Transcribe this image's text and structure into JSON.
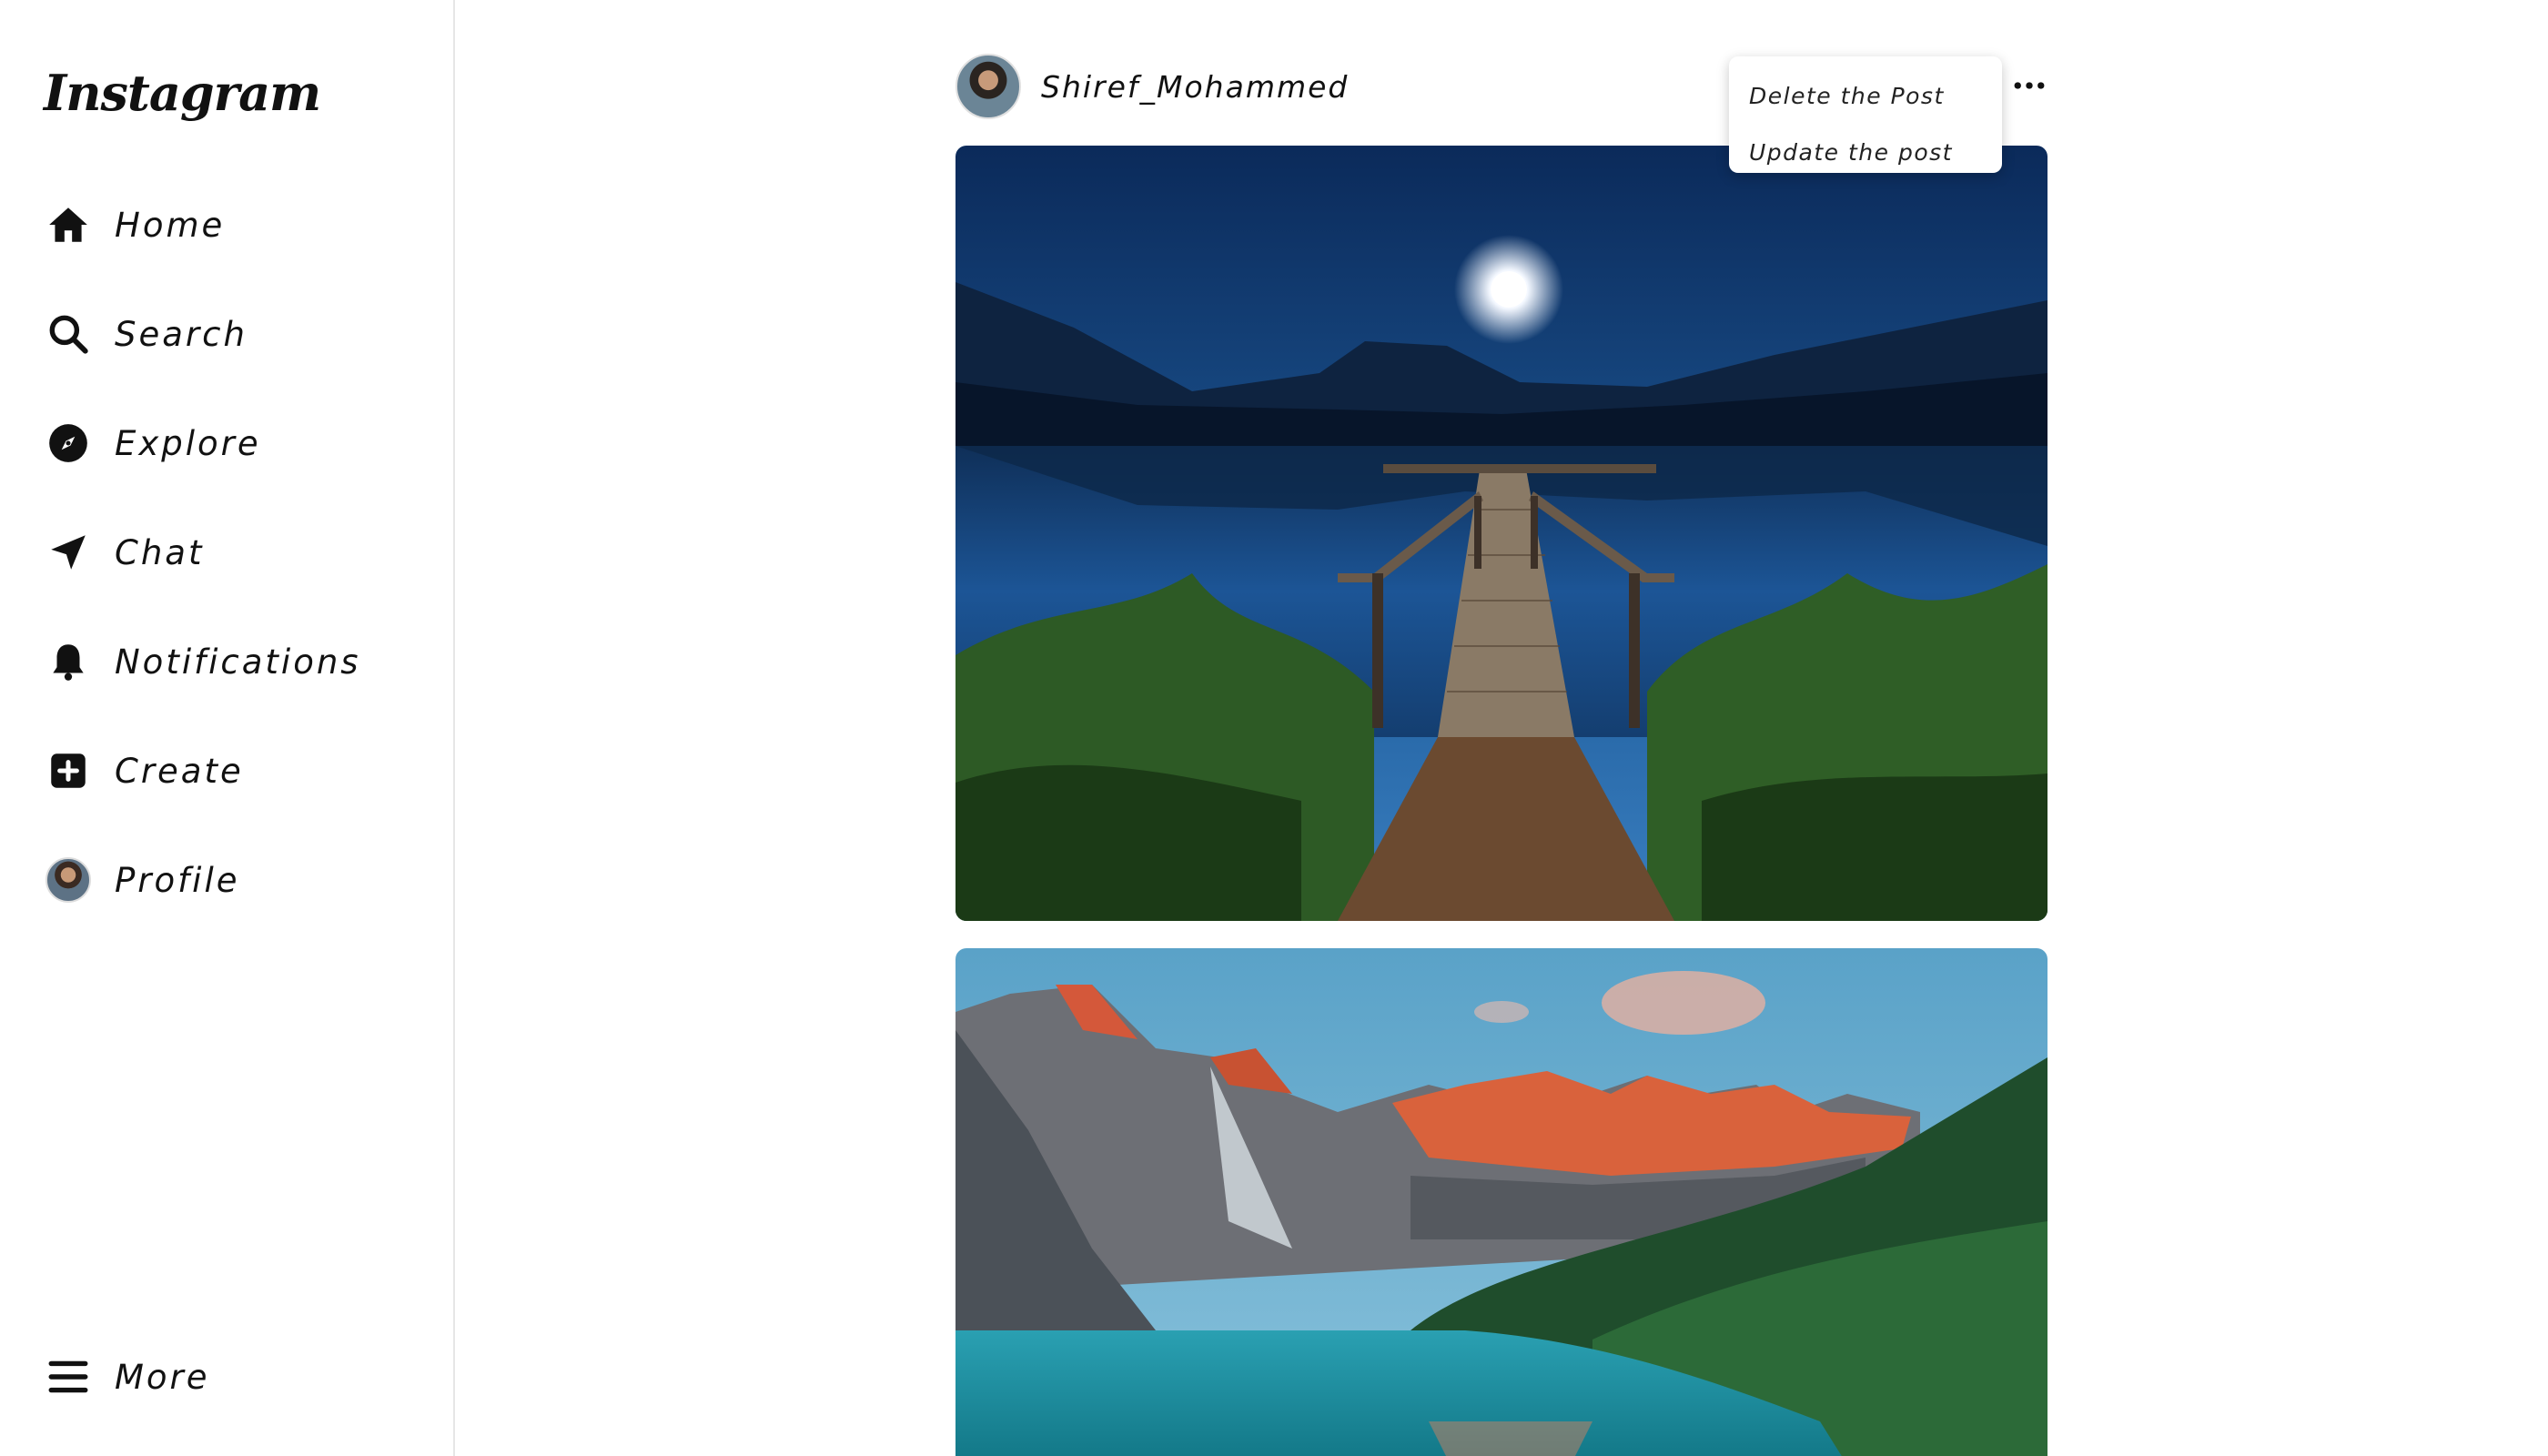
{
  "app": {
    "logo_text": "Instagram"
  },
  "sidebar": {
    "items": [
      {
        "label": "Home",
        "icon": "home-icon"
      },
      {
        "label": "Search",
        "icon": "search-icon"
      },
      {
        "label": "Explore",
        "icon": "compass-icon"
      },
      {
        "label": "Chat",
        "icon": "send-icon"
      },
      {
        "label": "Notifications",
        "icon": "bell-icon"
      },
      {
        "label": "Create",
        "icon": "plus-square-icon"
      },
      {
        "label": "Profile",
        "icon": "avatar"
      }
    ],
    "more_label": "More",
    "more_icon": "hamburger-icon"
  },
  "post": {
    "username": "Shiref_Mohammed",
    "options_icon": "ellipsis-icon",
    "menu": {
      "delete_label": "Delete the Post",
      "update_label": "Update the post"
    }
  },
  "colors": {
    "text": "#111111",
    "border": "#e6e6e6",
    "background": "#ffffff"
  }
}
